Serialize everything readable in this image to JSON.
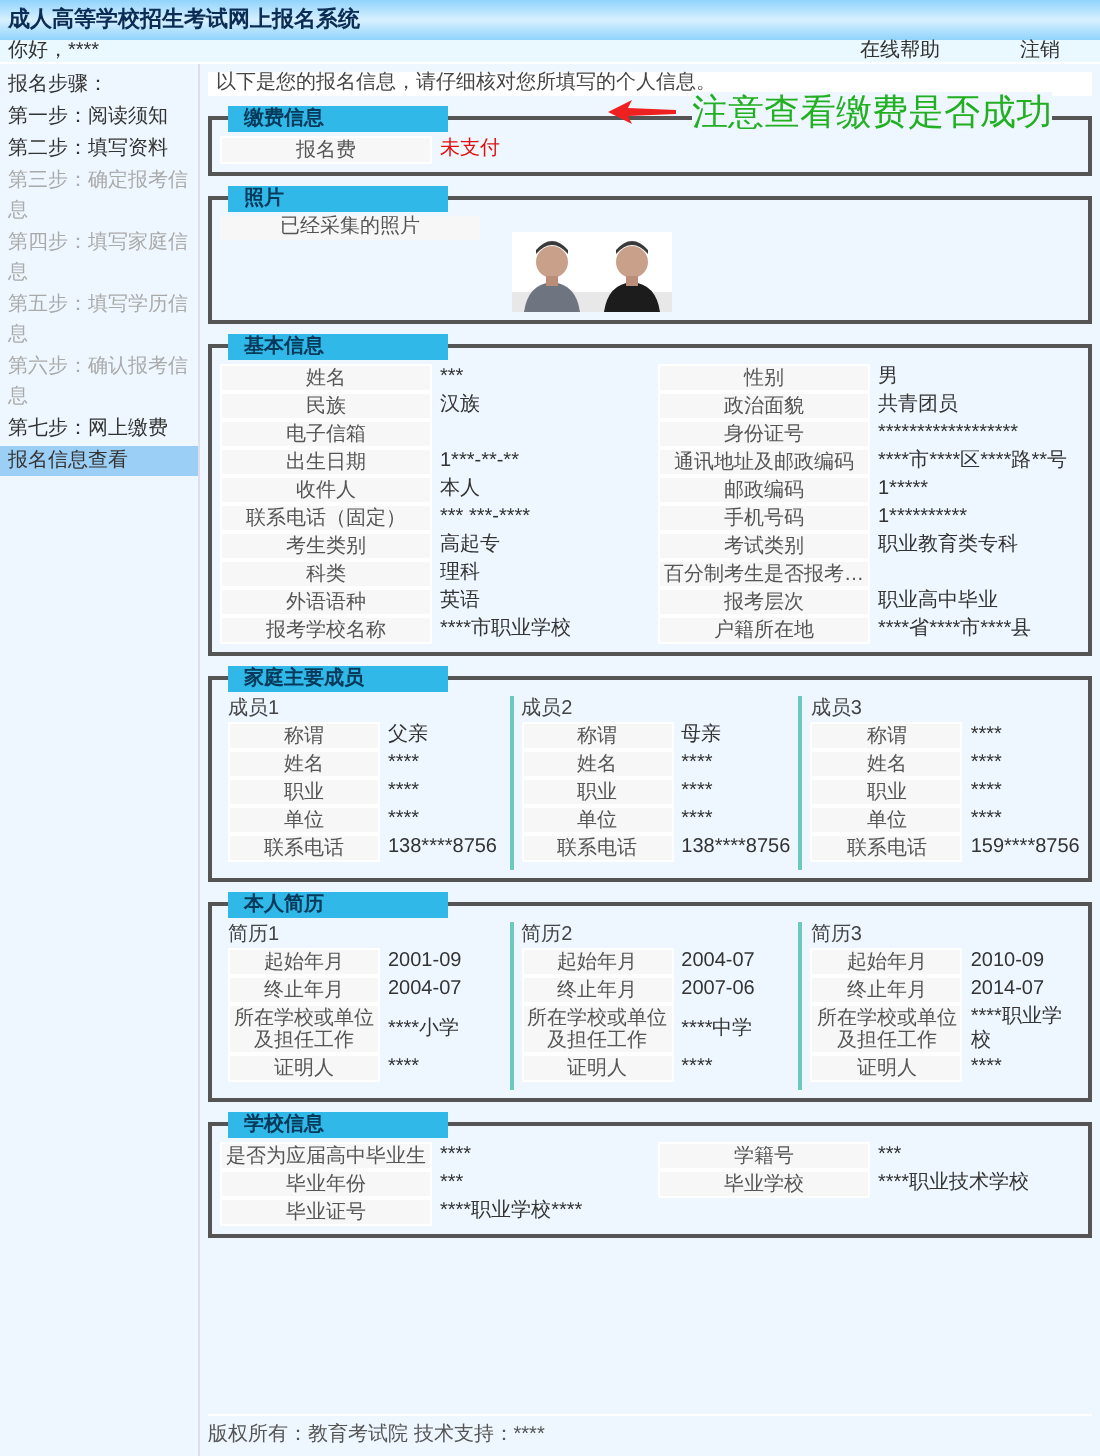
{
  "title": "成人高等学校招生考试网上报名系统",
  "header": {
    "user": "你好，****",
    "links": [
      "在线帮助",
      "注销"
    ]
  },
  "sidebar": {
    "heading": "报名步骤：",
    "items": [
      {
        "label": "第一步：阅读须知",
        "disabled": false,
        "selected": false
      },
      {
        "label": "第二步：填写资料",
        "disabled": false,
        "selected": false
      },
      {
        "label": "第三步：确定报考信息",
        "disabled": true,
        "selected": false
      },
      {
        "label": "第四步：填写家庭信息",
        "disabled": true,
        "selected": false
      },
      {
        "label": "第五步：填写学历信息",
        "disabled": true,
        "selected": false
      },
      {
        "label": "第六步：确认报考信息",
        "disabled": true,
        "selected": false
      },
      {
        "label": "第七步：网上缴费",
        "disabled": false,
        "selected": false
      },
      {
        "label": "报名信息查看",
        "disabled": false,
        "selected": true
      }
    ]
  },
  "notice": "以下是您的报名信息，请仔细核对您所填写的个人信息。",
  "annotation": "注意查看缴费是否成功",
  "sections": [
    {
      "kind": "fields",
      "title": "缴费信息",
      "rows": [
        {
          "label": "报名费",
          "value": "未支付",
          "alert": true
        }
      ]
    },
    {
      "kind": "photos",
      "title": "照片",
      "caption": "已经采集的照片"
    },
    {
      "kind": "fields",
      "title": "基本信息",
      "rows": [
        {
          "label": "姓名",
          "value": "***"
        },
        {
          "label": "性别",
          "value": "男"
        },
        {
          "label": "民族",
          "value": "汉族"
        },
        {
          "label": "政治面貌",
          "value": "共青团员"
        },
        {
          "label": "电子信箱",
          "value": ""
        },
        {
          "label": "身份证号",
          "value": "******************"
        },
        {
          "label": "出生日期",
          "value": "1***-**-**"
        },
        {
          "label": "通讯地址及邮政编码",
          "value": "****市****区****路**号"
        },
        {
          "label": "收件人",
          "value": "本人"
        },
        {
          "label": "邮政编码",
          "value": "1*****"
        },
        {
          "label": "联系电话（固定）",
          "value": "*** ***-****"
        },
        {
          "label": "手机号码",
          "value": "1**********"
        },
        {
          "label": "考生类别",
          "value": "高起专"
        },
        {
          "label": "考试类别",
          "value": "职业教育类专科"
        },
        {
          "label": "科类",
          "value": "理科"
        },
        {
          "label": "百分制考生是否报考…",
          "value": ""
        },
        {
          "label": "外语语种",
          "value": "英语"
        },
        {
          "label": "报考层次",
          "value": "职业高中毕业"
        },
        {
          "label": "报考学校名称",
          "value": "****市职业学校"
        },
        {
          "label": "户籍所在地",
          "value": "****省****市****县"
        }
      ]
    },
    {
      "kind": "groups",
      "title": "家庭主要成员",
      "groups": [
        {
          "title": "成员1",
          "rows": [
            {
              "label": "称谓",
              "value": "父亲"
            },
            {
              "label": "姓名",
              "value": "****"
            },
            {
              "label": "职业",
              "value": "****"
            },
            {
              "label": "单位",
              "value": "****"
            },
            {
              "label": "联系电话",
              "value": "138****8756"
            }
          ]
        },
        {
          "title": "成员2",
          "rows": [
            {
              "label": "称谓",
              "value": "母亲"
            },
            {
              "label": "姓名",
              "value": "****"
            },
            {
              "label": "职业",
              "value": "****"
            },
            {
              "label": "单位",
              "value": "****"
            },
            {
              "label": "联系电话",
              "value": "138****8756"
            }
          ]
        },
        {
          "title": "成员3",
          "rows": [
            {
              "label": "称谓",
              "value": "****"
            },
            {
              "label": "姓名",
              "value": "****"
            },
            {
              "label": "职业",
              "value": "****"
            },
            {
              "label": "单位",
              "value": "****"
            },
            {
              "label": "联系电话",
              "value": "159****8756"
            }
          ]
        }
      ]
    },
    {
      "kind": "groups",
      "title": "本人简历",
      "groups": [
        {
          "title": "简历1",
          "rows": [
            {
              "label": "起始年月",
              "value": "2001-09"
            },
            {
              "label": "终止年月",
              "value": "2004-07"
            },
            {
              "label": "所在学校或单位及担任工作",
              "value": "****小学"
            },
            {
              "label": "证明人",
              "value": "****"
            }
          ]
        },
        {
          "title": "简历2",
          "rows": [
            {
              "label": "起始年月",
              "value": "2004-07"
            },
            {
              "label": "终止年月",
              "value": "2007-06"
            },
            {
              "label": "所在学校或单位及担任工作",
              "value": "****中学"
            },
            {
              "label": "证明人",
              "value": "****"
            }
          ]
        },
        {
          "title": "简历3",
          "rows": [
            {
              "label": "起始年月",
              "value": "2010-09"
            },
            {
              "label": "终止年月",
              "value": "2014-07"
            },
            {
              "label": "所在学校或单位及担任工作",
              "value": "****职业学校"
            },
            {
              "label": "证明人",
              "value": "****"
            }
          ]
        }
      ]
    },
    {
      "kind": "fields",
      "title": "学校信息",
      "rows": [
        {
          "label": "是否为应届高中毕业生",
          "value": "****"
        },
        {
          "label": "学籍号",
          "value": "***"
        },
        {
          "label": "毕业年份",
          "value": "***"
        },
        {
          "label": "毕业学校",
          "value": "****职业技术学校"
        },
        {
          "label": "毕业证号",
          "value": "****职业学校****"
        }
      ]
    }
  ],
  "footer": "版权所有：教育考试院 技术支持：****"
}
